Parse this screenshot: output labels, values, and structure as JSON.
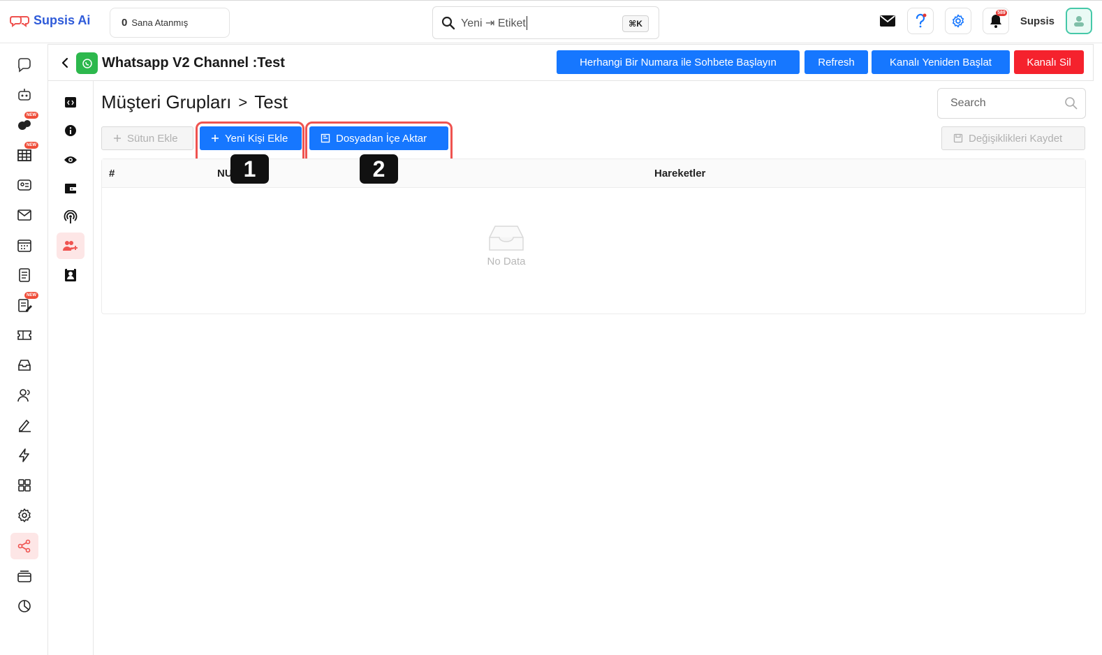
{
  "app": {
    "brand": "Supsis Ai",
    "assigned_count": "0",
    "assigned_label": "Sana Atanmış",
    "search_text": "Yeni ⇥ Etiket",
    "shortcut": "⌘K",
    "notification_count": "589",
    "user_name": "Supsis"
  },
  "sidebar": {
    "new_label": "NEW",
    "items": [
      {
        "icon": "chat-bubble-icon"
      },
      {
        "icon": "bot-icon"
      },
      {
        "icon": "social-icon",
        "badge": "NEW"
      },
      {
        "icon": "table-icon",
        "badge": "NEW"
      },
      {
        "icon": "contact-card-icon"
      },
      {
        "icon": "mail-icon"
      },
      {
        "icon": "calendar-icon"
      },
      {
        "icon": "notes-icon"
      },
      {
        "icon": "edit-list-icon",
        "badge": "NEW"
      },
      {
        "icon": "ticket-icon"
      },
      {
        "icon": "inbox-icon"
      },
      {
        "icon": "users-icon"
      },
      {
        "icon": "sign-icon"
      },
      {
        "icon": "lightning-icon"
      },
      {
        "icon": "apps-grid-icon"
      },
      {
        "icon": "settings-icon"
      },
      {
        "icon": "share-icon",
        "active": true
      },
      {
        "icon": "billing-icon"
      },
      {
        "icon": "reports-pie-icon"
      }
    ]
  },
  "channel": {
    "title": "Whatsapp V2 Channel :Test",
    "buttons": {
      "start_chat": "Herhangi Bir Numara ile Sohbete Başlayın",
      "refresh": "Refresh",
      "restart": "Kanalı Yeniden Başlat",
      "delete": "Kanalı Sil"
    }
  },
  "sub_sidebar": {
    "items": [
      {
        "icon": "code-icon"
      },
      {
        "icon": "info-icon"
      },
      {
        "icon": "eye-icon"
      },
      {
        "icon": "wallet-icon"
      },
      {
        "icon": "broadcast-icon"
      },
      {
        "icon": "user-add-icon",
        "active": true
      },
      {
        "icon": "contact-book-icon"
      }
    ]
  },
  "content": {
    "breadcrumb_parent": "Müşteri Grupları",
    "breadcrumb_sep": ">",
    "breadcrumb_current": "Test",
    "search_placeholder": "Search",
    "add_column": "Sütun Ekle",
    "add_person": "Yeni Kişi Ekle",
    "import_file": "Dosyadan İçe Aktar",
    "save_changes": "Değişiklikleri Kaydet",
    "markers": [
      "1",
      "2"
    ],
    "table": {
      "columns": [
        "#",
        "NU",
        "Hareketler"
      ],
      "empty_text": "No Data"
    }
  },
  "colors": {
    "primary": "#1677ff",
    "danger": "#f5222d",
    "highlight": "#ef5350",
    "active_bg": "#fde6e6",
    "whatsapp": "#2db84d"
  }
}
